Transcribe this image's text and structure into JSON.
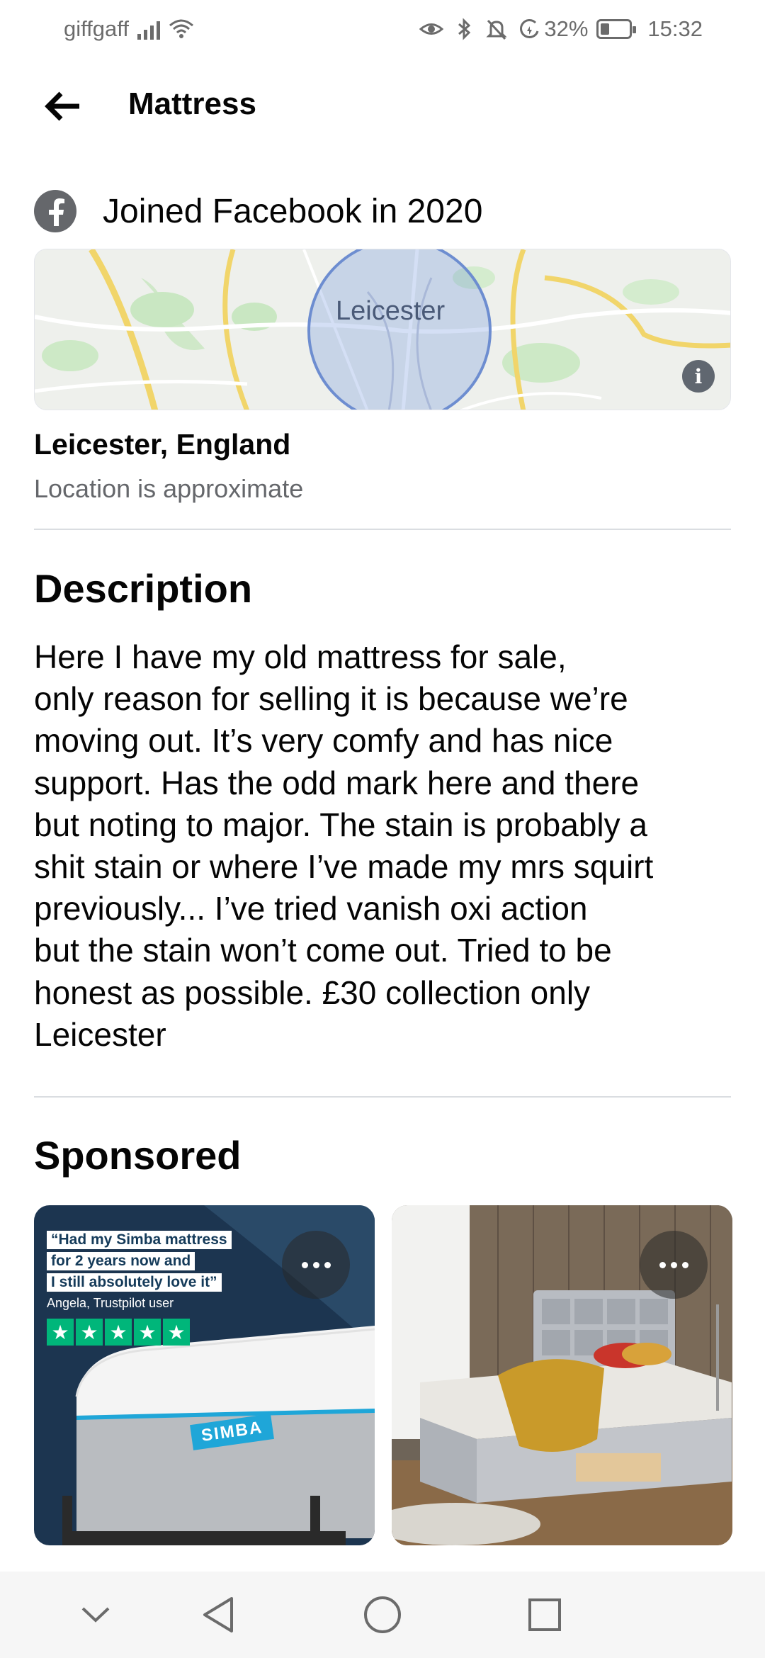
{
  "status_bar": {
    "carrier": "giffgaff",
    "battery_percent": "32%",
    "battery_level": 0.32,
    "time": "15:32",
    "icons": [
      "signal-icon",
      "wifi-icon",
      "eye-icon",
      "bluetooth-icon",
      "bell-off-icon",
      "battery-saver-icon",
      "battery-icon"
    ]
  },
  "header": {
    "title": "Mattress",
    "back_icon": "back-arrow-icon"
  },
  "seller": {
    "joined": "Joined Facebook in 2020"
  },
  "map": {
    "label": "Leicester",
    "info_icon": "i"
  },
  "location": {
    "city": "Leicester, England",
    "note": "Location is approximate"
  },
  "description": {
    "heading": "Description",
    "lines": [
      "Here I have my old mattress for sale,",
      "only reason for selling it is because we’re",
      "moving out. It’s very comfy and has nice",
      "support. Has the odd mark here and there",
      "but noting to major. The stain is probably a",
      "shit stain or where I’ve made my mrs squirt",
      "previously... I’ve tried vanish oxi action",
      "but the stain won’t come out. Tried to be",
      "honest as possible. £30 collection only",
      "Leicester"
    ]
  },
  "sponsored": {
    "heading": "Sponsored",
    "ads": [
      {
        "quote_lines": [
          "“Had my Simba mattress",
          "for 2 years now and",
          "I still absolutely love it”"
        ],
        "attribution": "Angela, Trustpilot user",
        "rating": 5,
        "brand": "SIMBA"
      },
      {
        "image": "grey crushed velvet divan bed"
      }
    ]
  },
  "nav": {
    "buttons": [
      "chevron-down-icon",
      "back-triangle-icon",
      "home-circle-icon",
      "recents-square-icon"
    ]
  }
}
